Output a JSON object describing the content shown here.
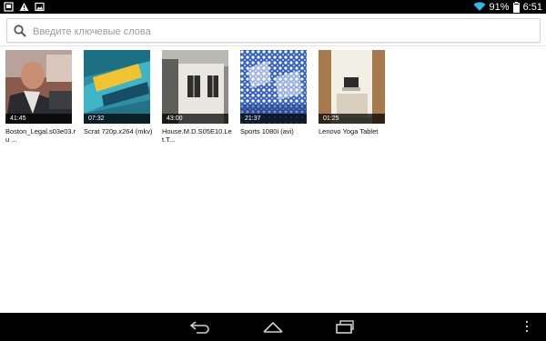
{
  "status_bar": {
    "battery_percent": "91%",
    "time": "6:51",
    "icons": [
      "tablet-icon",
      "warning-icon",
      "image-icon",
      "wifi-icon",
      "battery-icon"
    ]
  },
  "search": {
    "placeholder": "Введите ключевые слова",
    "value": ""
  },
  "videos": [
    {
      "title": "Boston_Legal.s03e03.ru ...",
      "duration": "41:45"
    },
    {
      "title": "Scrat 720p.x264 (mkv)",
      "duration": "07:32"
    },
    {
      "title": "House.M.D.S05E10.Let.T...",
      "duration": "43:00"
    },
    {
      "title": "Sports 1080i (avi)",
      "duration": "21:37"
    },
    {
      "title": "Lenovo Yoga Tablet",
      "duration": "01:25"
    }
  ],
  "nav_bar": {
    "icons": [
      "back-icon",
      "home-icon",
      "recent-apps-icon",
      "overflow-menu-icon"
    ]
  }
}
